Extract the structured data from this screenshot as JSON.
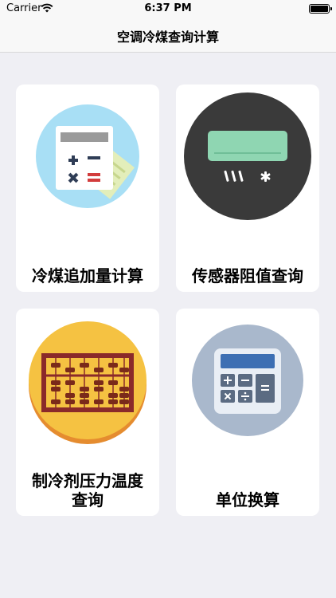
{
  "status_bar": {
    "carrier": "Carrier",
    "time": "6:37 PM"
  },
  "nav": {
    "title": "空调冷煤查询计算"
  },
  "cards": [
    {
      "label": "冷煤追加量计算",
      "icon": "calculator-paper-icon"
    },
    {
      "label": "传感器阻值查询",
      "icon": "air-conditioner-icon"
    },
    {
      "label_line1": "制冷剂压力温度",
      "label_line2": "查询",
      "icon": "abacus-icon"
    },
    {
      "label": "单位换算",
      "icon": "unit-calculator-icon"
    }
  ],
  "colors": {
    "background": "#efeff4",
    "card": "#ffffff",
    "icon1_circle": "#a8dff5",
    "icon2_circle": "#3a3a3a",
    "icon3_circle": "#f5c242",
    "icon4_circle": "#a9b8cc"
  }
}
